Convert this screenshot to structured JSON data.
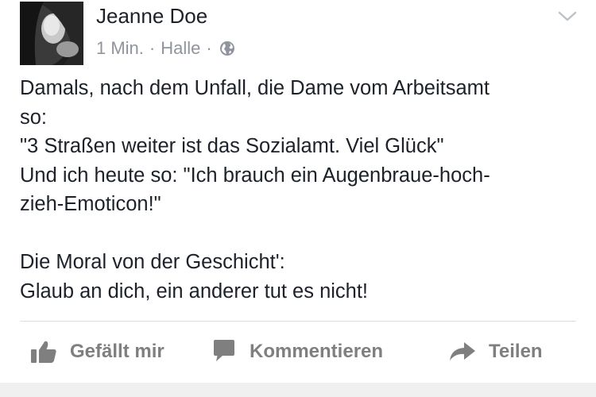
{
  "post": {
    "author": "Jeanne Doe",
    "time": "1 Min.",
    "separator": "·",
    "location": "Halle",
    "privacy_icon": "globe-icon",
    "menu_icon": "chevron-down-icon",
    "text_lines": [
      "Damals, nach dem Unfall, die Dame vom Arbeitsamt",
      "so:",
      "\"3 Straßen weiter ist das Sozialamt. Viel Glück\"",
      "Und ich heute so: \"Ich brauch ein Augenbraue-hoch-",
      "zieh-Emoticon!\"",
      "",
      "Die Moral von der Geschicht':",
      "Glaub an dich, ein anderer tut es nicht!"
    ]
  },
  "actions": {
    "like": {
      "label": "Gefällt mir",
      "icon": "thumbs-up-icon"
    },
    "comment": {
      "label": "Kommentieren",
      "icon": "comment-icon"
    },
    "share": {
      "label": "Teilen",
      "icon": "share-arrow-icon"
    }
  },
  "colors": {
    "text": "#1d2129",
    "meta": "#90949c",
    "action": "#7f7f7f",
    "divider": "#dadde1"
  }
}
